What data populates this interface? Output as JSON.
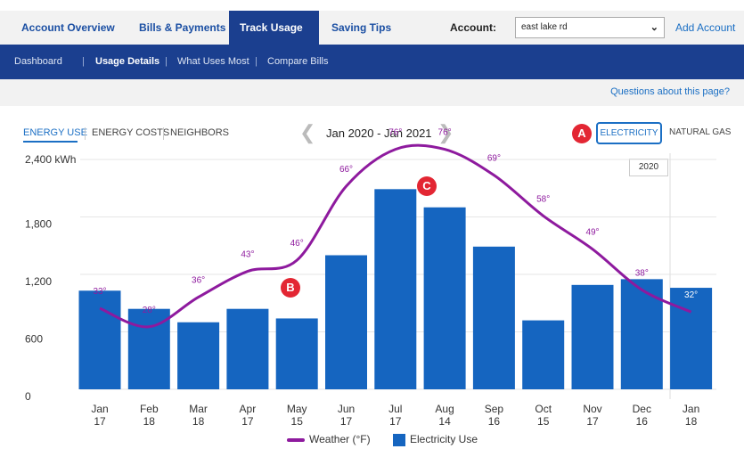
{
  "top_nav": {
    "tabs": [
      {
        "label": "Account Overview",
        "active": false
      },
      {
        "label": "Bills & Payments",
        "active": false
      },
      {
        "label": "Track Usage",
        "active": true
      },
      {
        "label": "Saving Tips",
        "active": false
      }
    ],
    "account_label": "Account:",
    "account_value": "east lake rd",
    "add_account": "Add Account"
  },
  "sub_nav": {
    "items": [
      {
        "label": "Dashboard",
        "active": false
      },
      {
        "label": "Usage Details",
        "active": true
      },
      {
        "label": "What Uses Most",
        "active": false
      },
      {
        "label": "Compare Bills",
        "active": false
      }
    ],
    "separator": "|"
  },
  "questions_link": "Questions about this page?",
  "view_toggles": [
    {
      "label": "ENERGY USE",
      "active": true
    },
    {
      "label": "ENERGY COSTS",
      "active": false
    },
    {
      "label": "NEIGHBORS",
      "active": false
    }
  ],
  "period": "Jan 2020 - Jan 2021",
  "fuel_toggles": {
    "electricity": "ELECTRICITY",
    "natural_gas": "NATURAL GAS"
  },
  "markers": {
    "a": "A",
    "b": "B",
    "c": "C"
  },
  "year_label": "2020",
  "legend": {
    "weather": "Weather (°F)",
    "electricity": "Electricity Use"
  },
  "colors": {
    "bar": "#1565c0",
    "weather_line": "#8e1a9e",
    "accent": "#1b6fc4",
    "nav": "#1b3f8f",
    "marker": "#e32633"
  },
  "chart_data": {
    "type": "bar",
    "y_ticks": [
      "2,400 kWh",
      "1,800",
      "1,200",
      "600",
      "0"
    ],
    "y_tick_values": [
      2400,
      1800,
      1200,
      600,
      0
    ],
    "ylim": [
      0,
      2400
    ],
    "categories": [
      {
        "month": "Jan",
        "day": "17"
      },
      {
        "month": "Feb",
        "day": "18"
      },
      {
        "month": "Mar",
        "day": "18"
      },
      {
        "month": "Apr",
        "day": "17"
      },
      {
        "month": "May",
        "day": "15"
      },
      {
        "month": "Jun",
        "day": "17"
      },
      {
        "month": "Jul",
        "day": "17"
      },
      {
        "month": "Aug",
        "day": "14"
      },
      {
        "month": "Sep",
        "day": "16"
      },
      {
        "month": "Oct",
        "day": "15"
      },
      {
        "month": "Nov",
        "day": "17"
      },
      {
        "month": "Dec",
        "day": "16"
      },
      {
        "month": "Jan",
        "day": "18"
      }
    ],
    "series": [
      {
        "name": "Electricity Use",
        "values": [
          1030,
          840,
          700,
          840,
          740,
          1400,
          2090,
          1900,
          1490,
          720,
          1090,
          1150,
          1060
        ]
      },
      {
        "name": "Weather (°F)",
        "values": [
          33,
          28,
          36,
          43,
          46,
          66,
          76,
          76,
          69,
          58,
          49,
          38,
          32
        ],
        "labels": [
          "33°",
          "28°",
          "36°",
          "43°",
          "46°",
          "66°",
          "76°",
          "76°",
          "69°",
          "58°",
          "49°",
          "38°",
          "32°"
        ]
      }
    ],
    "legend": "bottom-center",
    "grid": true
  }
}
